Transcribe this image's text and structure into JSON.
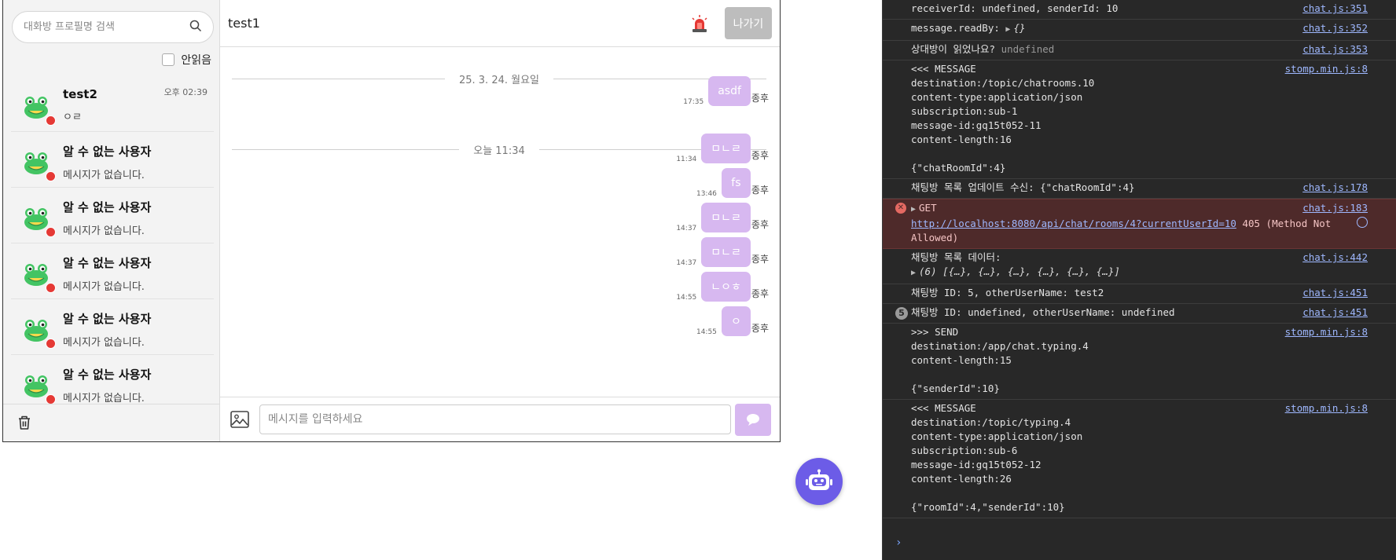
{
  "sidebar": {
    "search_placeholder": "대화방 프로필명 검색",
    "unread_label": "안읽음",
    "rooms": [
      {
        "name": "test2",
        "preview": "ㅇㄹ",
        "time": "오후 02:39"
      },
      {
        "name": "알 수 없는 사용자",
        "preview": "메시지가 없습니다.",
        "time": ""
      },
      {
        "name": "알 수 없는 사용자",
        "preview": "메시지가 없습니다.",
        "time": ""
      },
      {
        "name": "알 수 없는 사용자",
        "preview": "메시지가 없습니다.",
        "time": ""
      },
      {
        "name": "알 수 없는 사용자",
        "preview": "메시지가 없습니다.",
        "time": ""
      },
      {
        "name": "알 수 없는 사용자",
        "preview": "메시지가 없습니다.",
        "time": ""
      }
    ]
  },
  "chat": {
    "title": "test1",
    "leave_label": "나가기",
    "date_dividers": [
      "25. 3. 24. 월요일",
      "오늘 11:34"
    ],
    "messages": [
      {
        "text": "asdf",
        "time": "17:35",
        "status": "종후"
      },
      {
        "text": "ㅁㄴㄹ",
        "time": "11:34",
        "status": "종후"
      },
      {
        "text": "fs",
        "time": "13:46",
        "status": "종후"
      },
      {
        "text": "ㅁㄴㄹ",
        "time": "14:37",
        "status": "종후"
      },
      {
        "text": "ㅁㄴㄹ",
        "time": "14:37",
        "status": "종후"
      },
      {
        "text": "ㄴㅇㅎ",
        "time": "14:55",
        "status": "종후"
      },
      {
        "text": "ㅇ",
        "time": "14:55",
        "status": "종후"
      }
    ],
    "input_placeholder": "메시지를 입력하세요"
  },
  "console": {
    "logs": [
      {
        "text": "receiverId: undefined, senderId: 10",
        "src": "chat.js:351"
      },
      {
        "text": "message.readBy:",
        "obj": "{}",
        "src": "chat.js:352"
      },
      {
        "text": "상대방이 읽었나요?",
        "dim": "undefined",
        "src": "chat.js:353"
      },
      {
        "text": "<<< MESSAGE\ndestination:/topic/chatrooms.10\ncontent-type:application/json\nsubscription:sub-1\nmessage-id:gq15t052-11\ncontent-length:16\n\n{\"chatRoomId\":4}",
        "src": "stomp.min.js:8"
      },
      {
        "text": "채팅방 목록 업데이트 수신: {\"chatRoomId\":4}",
        "src": "chat.js:178"
      },
      {
        "error_method": "GET",
        "error_url": "http://localhost:8080/api/chat/rooms/4?currentUserId=10",
        "error_suffix": "405 (Method Not\nAllowed)",
        "src": "chat.js:183"
      },
      {
        "text": "채팅방 목록 데이터:",
        "obj": "(6) [{…}, {…}, {…}, {…}, {…}, {…}]",
        "src": "chat.js:442"
      },
      {
        "text": "채팅방 ID: 5, otherUserName: test2",
        "src": "chat.js:451"
      },
      {
        "count": "5",
        "text": "채팅방 ID: undefined, otherUserName: undefined",
        "src": "chat.js:451"
      },
      {
        "text": ">>> SEND\ndestination:/app/chat.typing.4\ncontent-length:15\n\n{\"senderId\":10}",
        "src": "stomp.min.js:8"
      },
      {
        "text": "<<< MESSAGE\ndestination:/topic/typing.4\ncontent-type:application/json\nsubscription:sub-6\nmessage-id:gq15t052-12\ncontent-length:26\n\n{\"roomId\":4,\"senderId\":10}",
        "src": "stomp.min.js:8"
      }
    ],
    "prompt": "›"
  }
}
